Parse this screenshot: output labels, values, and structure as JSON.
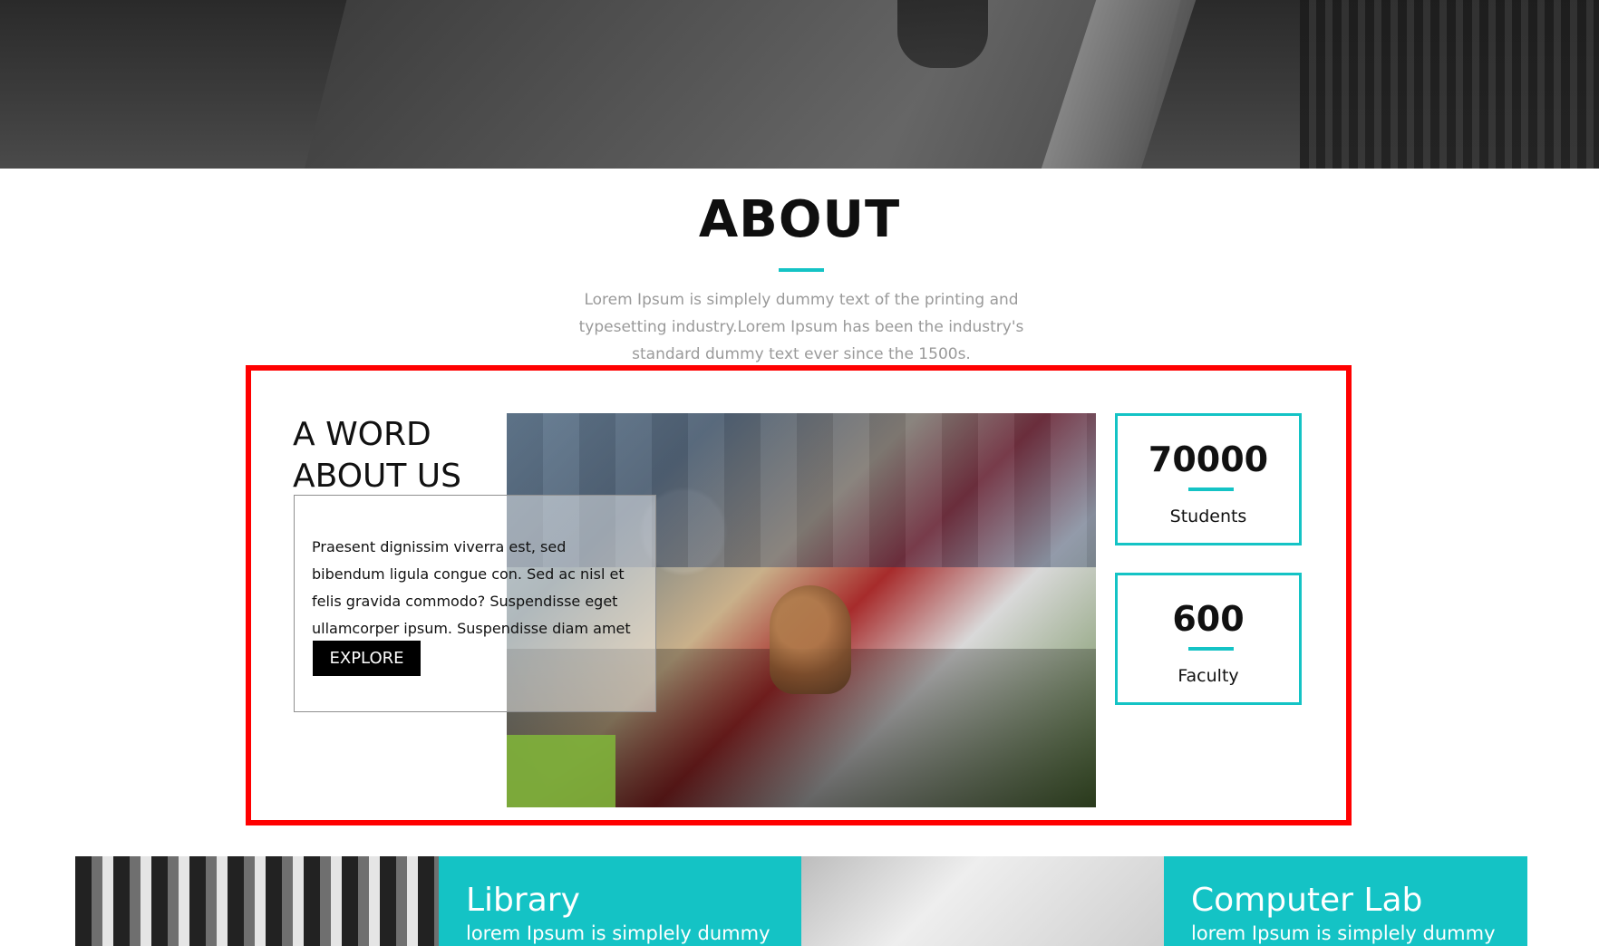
{
  "about": {
    "title": "ABOUT",
    "description": "Lorem Ipsum is simplely dummy text of the printing and typesetting industry.Lorem Ipsum has been the industry's standard dummy text ever since the 1500s."
  },
  "word_about": {
    "heading_line1": "A WORD",
    "heading_line2": "ABOUT US",
    "text": "Praesent dignissim viverra est, sed bibendum ligula congue con. Sed ac nisl et felis gravida commodo? Suspendisse eget ullamcorper ipsum. Suspendisse diam amet",
    "button_label": "EXPLORE"
  },
  "stats": [
    {
      "number": "70000",
      "label": "Students"
    },
    {
      "number": "600",
      "label": "Faculty"
    }
  ],
  "facilities": [
    {
      "title": "Library",
      "subtitle": "lorem Ipsum is simplely dummy"
    },
    {
      "title": "Computer Lab",
      "subtitle": "lorem Ipsum is simplely dummy"
    }
  ],
  "colors": {
    "accent": "#14c3c5",
    "highlight_frame": "#ff0000",
    "button_bg": "#000000"
  }
}
